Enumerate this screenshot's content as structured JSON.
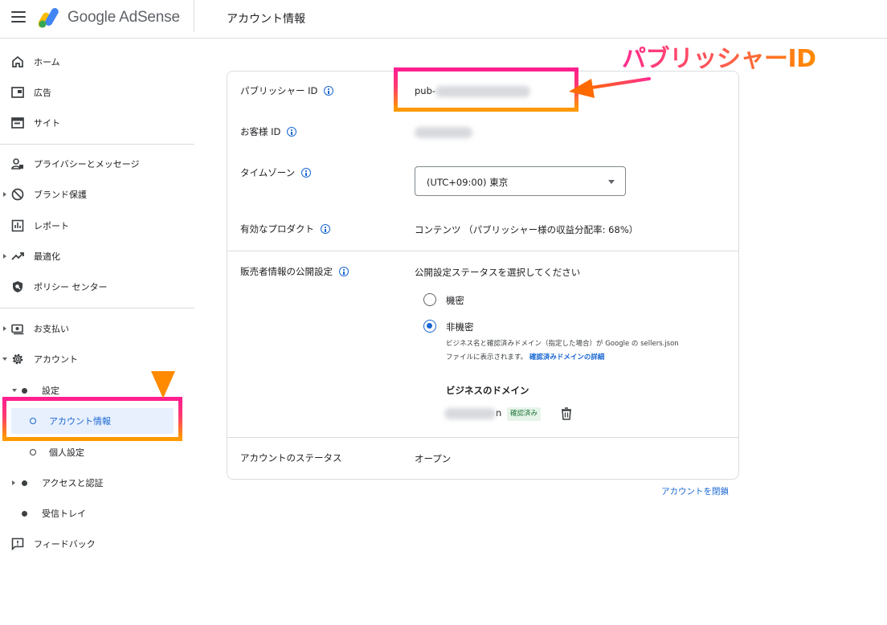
{
  "header": {
    "brand": "Google AdSense",
    "page_title": "アカウント情報"
  },
  "sidebar": {
    "items": [
      {
        "label": "ホーム",
        "icon": "home-icon"
      },
      {
        "label": "広告",
        "icon": "ads-icon"
      },
      {
        "label": "サイト",
        "icon": "sites-icon"
      },
      {
        "label": "プライバシーとメッセージ",
        "icon": "privacy-icon"
      },
      {
        "label": "ブランド保護",
        "icon": "block-icon"
      },
      {
        "label": "レポート",
        "icon": "reports-icon"
      },
      {
        "label": "最適化",
        "icon": "trending-icon"
      },
      {
        "label": "ポリシー センター",
        "icon": "policy-shield-icon"
      },
      {
        "label": "お支払い",
        "icon": "payments-icon"
      },
      {
        "label": "アカウント",
        "icon": "gear-icon"
      },
      {
        "label": "設定"
      },
      {
        "label": "アカウント情報"
      },
      {
        "label": "個人設定"
      },
      {
        "label": "アクセスと認証"
      },
      {
        "label": "受信トレイ"
      },
      {
        "label": "フィードバック",
        "icon": "feedback-icon"
      }
    ]
  },
  "account": {
    "publisher_id_label": "パブリッシャー ID",
    "publisher_id_value": "pub-",
    "customer_id_label": "お客様 ID",
    "timezone_label": "タイムゾーン",
    "timezone_value": "(UTC+09:00) 東京",
    "active_products_label": "有効なプロダクト",
    "active_products_value": "コンテンツ （パブリッシャー様の収益分配率: 68%）",
    "seller_info_label": "販売者情報の公開設定",
    "seller_info_prompt": "公開設定ステータスを選択してください",
    "radio_confidential": "機密",
    "radio_transparent": "非機密",
    "transparent_desc": "ビジネス名と確認済みドメイン（指定した場合）が Google の sellers.json ファイルに表示されます。",
    "transparent_link": "確認済みドメインの詳細",
    "business_domain_title": "ビジネスのドメイン",
    "domain_suffix": "n",
    "verified_badge": "確認済み",
    "account_status_label": "アカウントのステータス",
    "account_status_value": "オープン",
    "close_account_link": "アカウントを閉鎖"
  },
  "annotation": {
    "text": "パブリッシャーID"
  },
  "colors": {
    "accent": "#1967d2",
    "highlight_pink": "#ff1f8e",
    "highlight_orange": "#ff9a00"
  }
}
